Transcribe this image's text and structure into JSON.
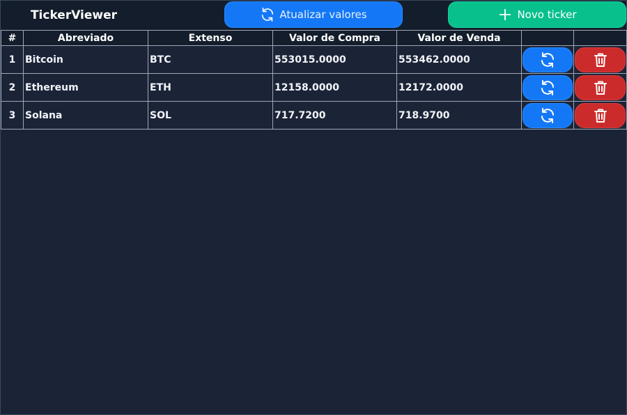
{
  "app": {
    "title": "TickerViewer"
  },
  "toolbar": {
    "refresh_label": "Atualizar valores",
    "new_label": "Novo ticker"
  },
  "table": {
    "headers": [
      "#",
      "Abreviado",
      "Extenso",
      "Valor de Compra",
      "Valor de Venda",
      "",
      ""
    ],
    "rows": [
      {
        "index": "1",
        "abbrev": "Bitcoin",
        "name": "BTC",
        "buy": "553015.0000",
        "sell": "553462.0000"
      },
      {
        "index": "2",
        "abbrev": "Ethereum",
        "name": "ETH",
        "buy": "12158.0000",
        "sell": "12172.0000"
      },
      {
        "index": "3",
        "abbrev": "Solana",
        "name": "SOL",
        "buy": "717.7200",
        "sell": "718.9700"
      }
    ]
  },
  "icons": {
    "refresh": "refresh-icon",
    "plus": "plus-icon",
    "delete": "trash-icon"
  },
  "colors": {
    "background": "#1b2437",
    "topbar": "#141d2b",
    "primary": "#1478f6",
    "success": "#08c08c",
    "danger": "#cc2b2b"
  }
}
